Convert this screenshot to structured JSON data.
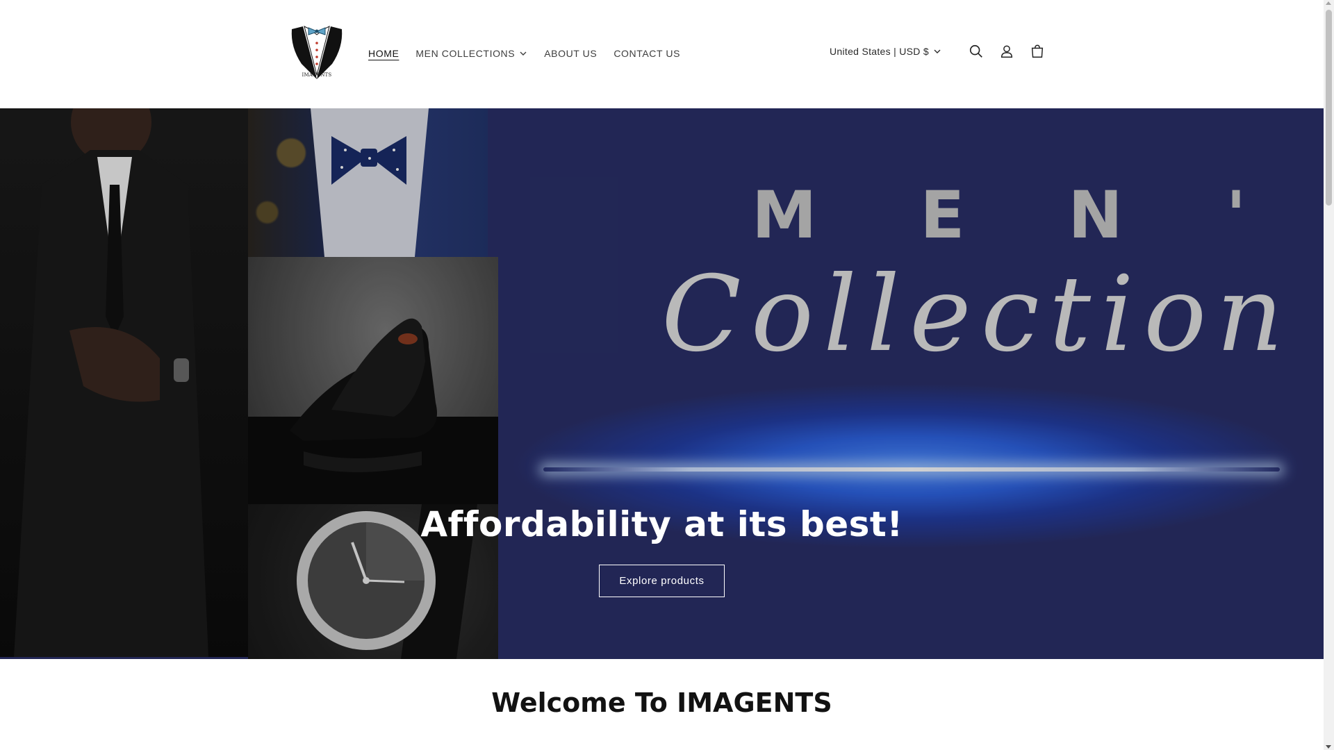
{
  "header": {
    "logo_text": "IMAGENTS",
    "nav": [
      {
        "label": "HOME",
        "active": true
      },
      {
        "label": "MEN COLLECTIONS",
        "has_dropdown": true
      },
      {
        "label": "ABOUT US"
      },
      {
        "label": "CONTACT US"
      }
    ],
    "locale": "United States | USD $",
    "icons": [
      "search-icon",
      "account-icon",
      "cart-icon"
    ]
  },
  "hero": {
    "image_title_top": "M E N ' S",
    "image_title_script": "Collection",
    "heading": "Affordability at its best!",
    "button_label": "Explore products",
    "colors": {
      "background": "#2a2f68",
      "glow": "#2d62e0",
      "text": "#ffffff"
    }
  },
  "welcome": {
    "heading": "Welcome To IMAGENTS"
  }
}
